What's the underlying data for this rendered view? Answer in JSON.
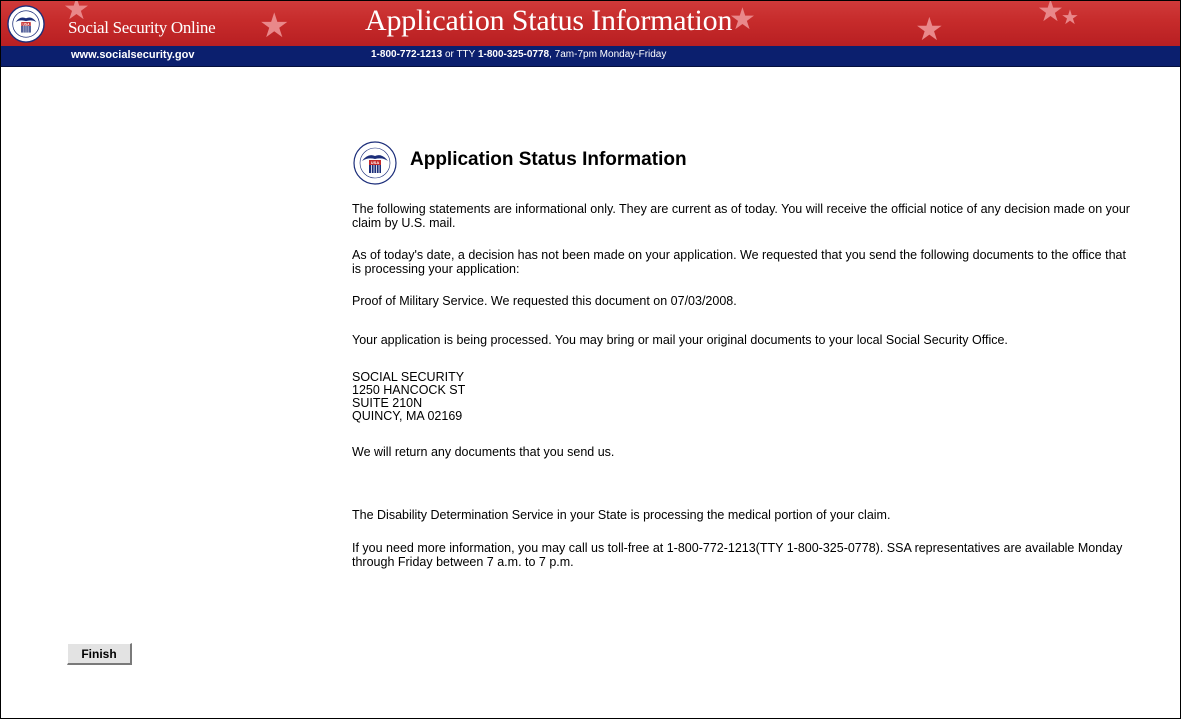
{
  "header": {
    "site_name": "Social Security Online",
    "banner_title": "Application Status Information",
    "site_url": "www.socialsecurity.gov",
    "phone_main": "1-800-772-1213",
    "phone_or_tty": " or TTY ",
    "phone_tty": "1-800-325-0778",
    "phone_hours": ", 7am-7pm Monday-Friday",
    "seal_text": "USA"
  },
  "main": {
    "heading": "Application Status Information",
    "paragraphs": [
      "The following statements are informational only. They are current as of today. You will receive the official notice of any decision made on your claim by U.S. mail.",
      "As of today's date, a decision has not been made on your application. We requested that you send the following documents to the office that is processing your application:",
      "Proof of Military Service. We requested this document on 07/03/2008.",
      "Your application is being processed. You may bring or mail your original documents to your local Social Security Office.",
      "We will return any documents that you send us.",
      "The Disability Determination Service in your State is processing the medical portion of your claim.",
      "If you need more information, you may call us toll-free at 1-800-772-1213(TTY 1-800-325-0778). SSA representatives are available Monday through Friday between 7 a.m. to 7 p.m."
    ],
    "address": {
      "line1": "SOCIAL SECURITY",
      "line2": "1250 HANCOCK ST",
      "line3": "SUITE 210N",
      "line4": "QUINCY, MA 02169"
    }
  },
  "footer": {
    "finish_label": "Finish"
  },
  "colors": {
    "banner_red": "#c62b2b",
    "navy_bar": "#0b1f6e"
  }
}
